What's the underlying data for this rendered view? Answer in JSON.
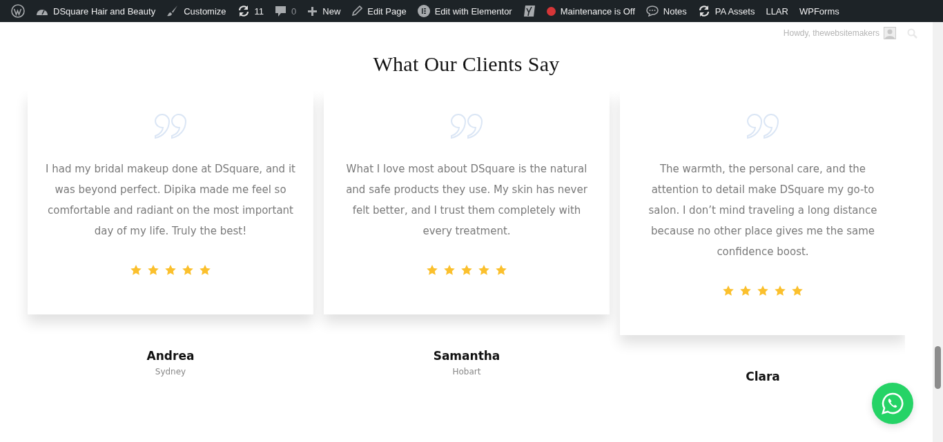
{
  "admin_bar": {
    "items": [
      {
        "label": "DSquare Hair and Beauty",
        "muted": false
      },
      {
        "label": "Customize",
        "muted": false
      },
      {
        "label": "11",
        "muted": false
      },
      {
        "label": "0",
        "muted": true
      },
      {
        "label": "New",
        "muted": false
      },
      {
        "label": "Edit Page",
        "muted": false
      },
      {
        "label": "Edit with Elementor",
        "muted": false
      },
      {
        "label": "Maintenance is Off",
        "muted": false
      },
      {
        "label": "Notes",
        "muted": false
      },
      {
        "label": "PA Assets",
        "muted": false
      },
      {
        "label": "LLAR",
        "muted": false
      },
      {
        "label": "WPForms",
        "muted": false
      }
    ],
    "greeting": "Howdy, thewebsitemakers"
  },
  "section": {
    "title": "What Our Clients Say"
  },
  "testimonials": [
    {
      "text": "I had my bridal makeup done at DSquare, and it was beyond perfect. Dipika made me feel so comfortable and radiant on the most important day of my life. Truly the best!",
      "stars": 5,
      "name": "Andrea",
      "location": "Sydney"
    },
    {
      "text": "What I love most about DSquare is the natural and safe products they use. My skin has never felt better, and I trust them completely with every treatment.",
      "stars": 5,
      "name": "Samantha",
      "location": "Hobart"
    },
    {
      "text": "The warmth, the personal care, and the attention to detail make DSquare my go-to salon. I don’t mind traveling a long distance because no other place gives me the same confidence boost.",
      "stars": 5,
      "name": "Clara"
    }
  ]
}
